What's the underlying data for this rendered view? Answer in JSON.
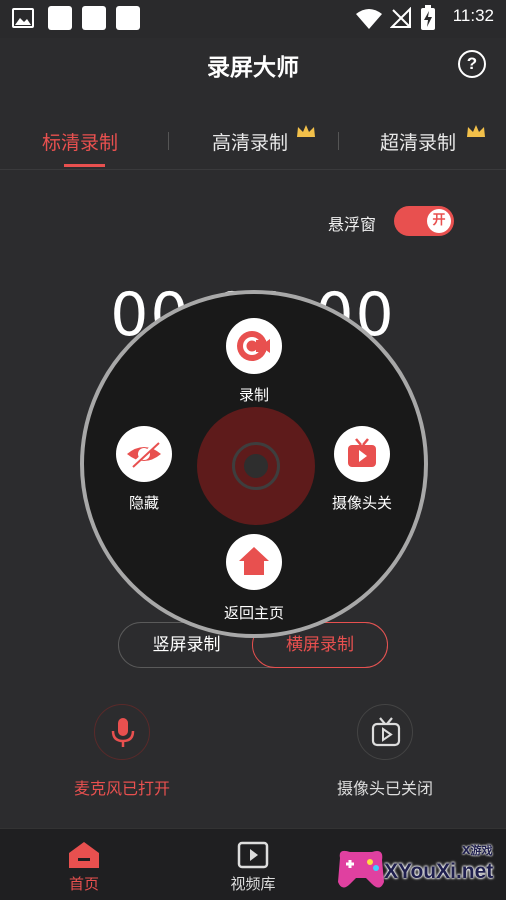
{
  "status_bar": {
    "time": "11:32"
  },
  "app": {
    "title": "录屏大师"
  },
  "tabs": [
    {
      "label": "标清录制",
      "active": true,
      "premium": false
    },
    {
      "label": "高清录制",
      "active": false,
      "premium": true
    },
    {
      "label": "超清录制",
      "active": false,
      "premium": true
    }
  ],
  "float_window": {
    "label": "悬浮窗",
    "toggle_text": "开",
    "on": true
  },
  "timer": "00:00:00",
  "orientation": {
    "portrait": "竖屏录制",
    "landscape": "横屏录制",
    "selected": "landscape"
  },
  "controls": {
    "mic": {
      "label": "麦克风已打开",
      "icon": "microphone-icon"
    },
    "camera": {
      "label": "摄像头已关闭",
      "icon": "tv-play-icon"
    }
  },
  "overlay_menu": {
    "record": {
      "label": "录制",
      "icon": "record-camera-icon"
    },
    "hide": {
      "label": "隐藏",
      "icon": "eye-off-icon"
    },
    "camera_off": {
      "label": "摄像头关",
      "icon": "tv-play-icon"
    },
    "home": {
      "label": "返回主页",
      "icon": "home-icon"
    }
  },
  "bottom_nav": [
    {
      "label": "首页",
      "icon": "home-icon",
      "active": true
    },
    {
      "label": "视频库",
      "icon": "video-library-icon",
      "active": false
    }
  ],
  "watermark": {
    "text": "XYouXi.net",
    "small": "X游戏"
  },
  "colors": {
    "accent": "#e8504f",
    "background": "#2c2c2e"
  }
}
